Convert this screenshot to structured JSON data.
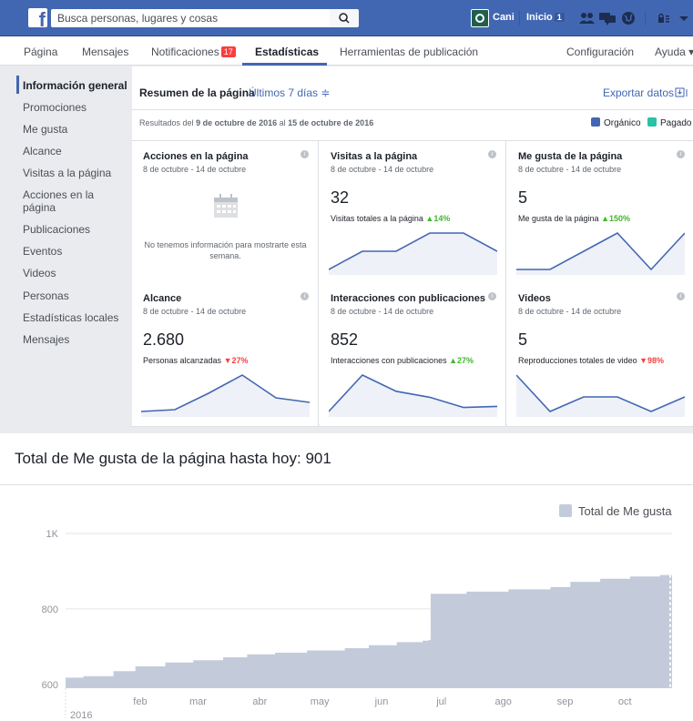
{
  "topbar": {
    "search_placeholder": "Busca personas, lugares y cosas",
    "user_name": "Cani",
    "home_label": "Inicio",
    "home_count": "1"
  },
  "nav": {
    "items": [
      {
        "label": "Página"
      },
      {
        "label": "Mensajes"
      },
      {
        "label": "Notificaciones",
        "badge": "17"
      },
      {
        "label": "Estadísticas"
      },
      {
        "label": "Herramientas de publicación"
      },
      {
        "label": "Configuración"
      },
      {
        "label": "Ayuda ▾"
      }
    ]
  },
  "sidebar": {
    "items": [
      {
        "label": "Información general"
      },
      {
        "label": "Promociones"
      },
      {
        "label": "Me gusta"
      },
      {
        "label": "Alcance"
      },
      {
        "label": "Visitas a la página"
      },
      {
        "label": "Acciones en la página"
      },
      {
        "label": "Publicaciones"
      },
      {
        "label": "Eventos"
      },
      {
        "label": "Videos"
      },
      {
        "label": "Personas"
      },
      {
        "label": "Estadísticas locales"
      },
      {
        "label": "Mensajes"
      }
    ]
  },
  "summary": {
    "title": "Resumen de la página",
    "range": "Últimos 7 días ≑",
    "export": "Exportar datos",
    "results_prefix": "Resultados del",
    "results_from": "9 de octubre de 2016",
    "results_mid": "al",
    "results_to": "15 de octubre de 2016",
    "legend_organic": "Orgánico",
    "legend_paid": "Pagado",
    "colors": {
      "organic": "#4267b2",
      "paid": "#29c2a4"
    }
  },
  "cards": [
    {
      "title": "Acciones en la página",
      "subtitle": "8 de octubre - 14 de octubre",
      "nodata": "No tenemos información para mostrarte esta semana."
    },
    {
      "title": "Visitas a la página",
      "subtitle": "8 de octubre - 14 de octubre",
      "value": "32",
      "label": "Visitas totales a la página",
      "change": "▲14%",
      "trend": "up",
      "spark": [
        2,
        4,
        4,
        6,
        6,
        4
      ]
    },
    {
      "title": "Me gusta de la página",
      "subtitle": "8 de octubre - 14 de octubre",
      "value": "5",
      "label": "Me gusta de la página",
      "change": "▲150%",
      "trend": "up",
      "spark": [
        0,
        0,
        1,
        2,
        0,
        2
      ]
    },
    {
      "title": "Alcance",
      "subtitle": "8 de octubre - 14 de octubre",
      "value": "2.680",
      "label": "Personas alcanzadas",
      "change": "▼27%",
      "trend": "down",
      "spark": [
        200,
        220,
        400,
        600,
        350,
        300
      ]
    },
    {
      "title": "Interacciones con publicaciones",
      "subtitle": "8 de octubre - 14 de octubre",
      "value": "852",
      "label": "Interacciones con publicaciones",
      "change": "▲27%",
      "trend": "up",
      "spark": [
        20,
        200,
        120,
        90,
        40,
        45
      ]
    },
    {
      "title": "Videos",
      "subtitle": "8 de octubre - 14 de octubre",
      "value": "5",
      "label": "Reproducciones totales de video",
      "change": "▼98%",
      "trend": "down",
      "spark": [
        5,
        0,
        2,
        2,
        0,
        2
      ]
    }
  ],
  "chart_data": {
    "type": "area",
    "title": "Total de Me gusta de la página hasta hoy: 901",
    "series": [
      {
        "name": "Total de Me gusta",
        "color": "#c3cbdb"
      }
    ],
    "ylim": [
      590,
      1000
    ],
    "yticks": [
      "600",
      "800",
      "1K"
    ],
    "xticks": [
      "feb",
      "mar",
      "abr",
      "may",
      "jun",
      "jul",
      "ago",
      "sep",
      "oct"
    ],
    "year_label": "2016",
    "grid": true,
    "legend": "top-right",
    "points": [
      [
        "2016-01-01",
        618
      ],
      [
        "2016-01-10",
        622
      ],
      [
        "2016-01-25",
        635
      ],
      [
        "2016-02-05",
        648
      ],
      [
        "2016-02-20",
        658
      ],
      [
        "2016-03-05",
        664
      ],
      [
        "2016-03-20",
        672
      ],
      [
        "2016-04-01",
        680
      ],
      [
        "2016-04-15",
        684
      ],
      [
        "2016-05-01",
        690
      ],
      [
        "2016-05-20",
        696
      ],
      [
        "2016-06-01",
        704
      ],
      [
        "2016-06-15",
        712
      ],
      [
        "2016-06-28",
        716
      ],
      [
        "2016-07-01",
        718
      ],
      [
        "2016-07-02",
        840
      ],
      [
        "2016-07-20",
        846
      ],
      [
        "2016-08-10",
        852
      ],
      [
        "2016-08-31",
        858
      ],
      [
        "2016-09-10",
        872
      ],
      [
        "2016-09-25",
        880
      ],
      [
        "2016-10-10",
        886
      ],
      [
        "2016-10-25",
        890
      ]
    ]
  }
}
